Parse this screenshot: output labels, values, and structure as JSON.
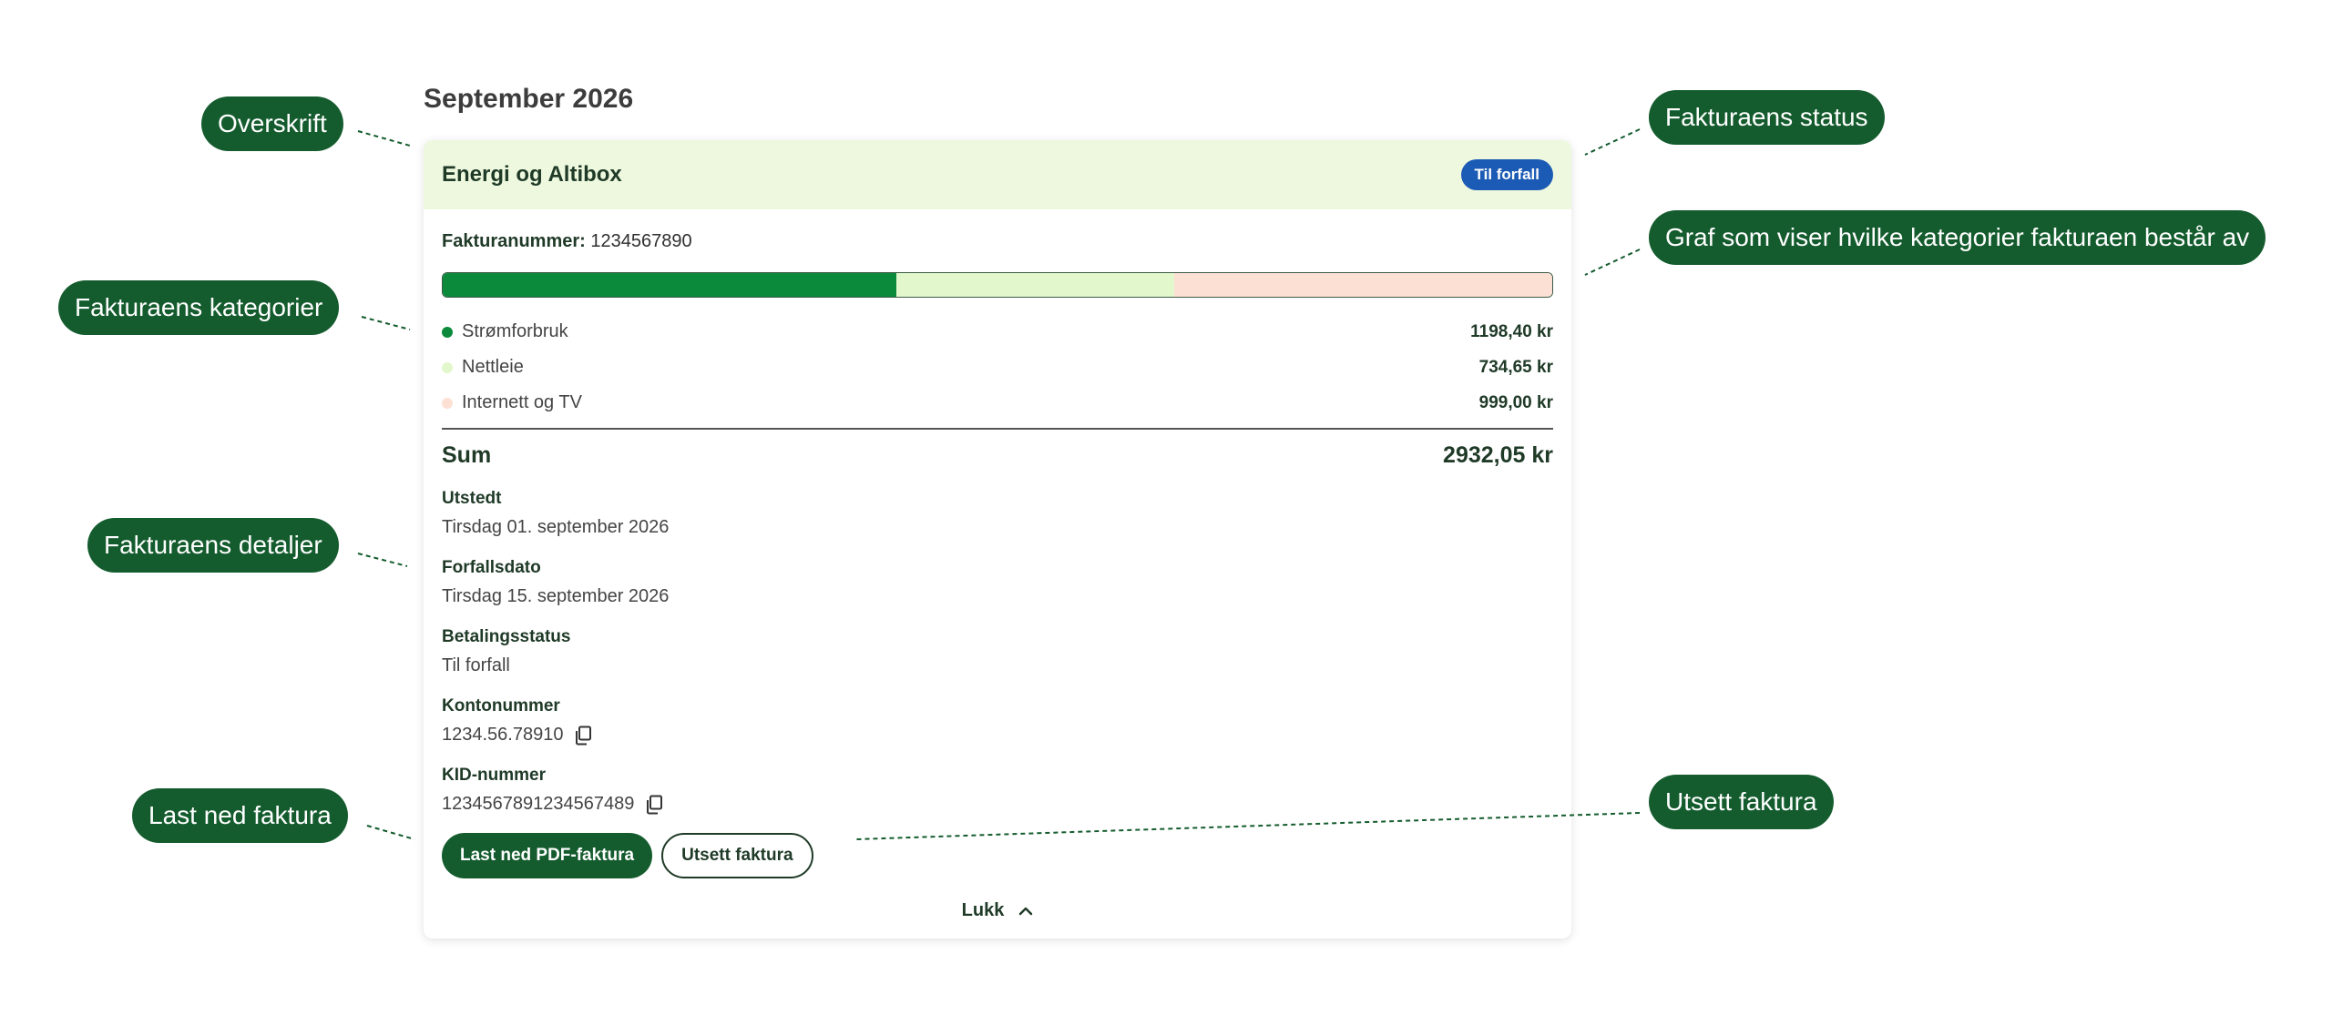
{
  "header": {
    "title": "September 2026"
  },
  "invoice": {
    "title": "Energi og Altibox",
    "status_badge": "Til forfall",
    "invoice_number_label": "Fakturanummer:",
    "invoice_number": "1234567890",
    "categories": [
      {
        "name": "Strømforbruk",
        "amount": "1198,40 kr",
        "value": 1198.4,
        "color": "#0b8a3c"
      },
      {
        "name": "Nettleie",
        "amount": "734,65 kr",
        "value": 734.65,
        "color": "#e3f7cc"
      },
      {
        "name": "Internett og TV",
        "amount": "999,00 kr",
        "value": 999.0,
        "color": "#fde0d4"
      }
    ],
    "sum_label": "Sum",
    "sum_value": "2932,05 kr",
    "details": {
      "issued_label": "Utstedt",
      "issued_value": "Tirsdag 01. september 2026",
      "due_label": "Forfallsdato",
      "due_value": "Tirsdag 15. september 2026",
      "payment_status_label": "Betalingsstatus",
      "payment_status_value": "Til forfall",
      "account_label": "Kontonummer",
      "account_value": "1234.56.78910",
      "kid_label": "KID-nummer",
      "kid_value": "1234567891234567489"
    },
    "actions": {
      "download_label": "Last ned PDF-faktura",
      "postpone_label": "Utsett faktura",
      "close_label": "Lukk"
    }
  },
  "callouts": {
    "heading": "Overskrift",
    "status": "Fakturaens status",
    "graph": "Graf som viser hvilke kategorier fakturaen består av",
    "categories": "Fakturaens kategorier",
    "details": "Fakturaens detaljer",
    "download": "Last ned faktura",
    "postpone": "Utsett faktura"
  },
  "colors": {
    "brand_green": "#145c2e",
    "header_bg": "#eef8df",
    "badge_blue": "#1c5bb5"
  },
  "icons": {
    "copy": "copy-icon",
    "close_chevron": "chevron-up-icon"
  }
}
